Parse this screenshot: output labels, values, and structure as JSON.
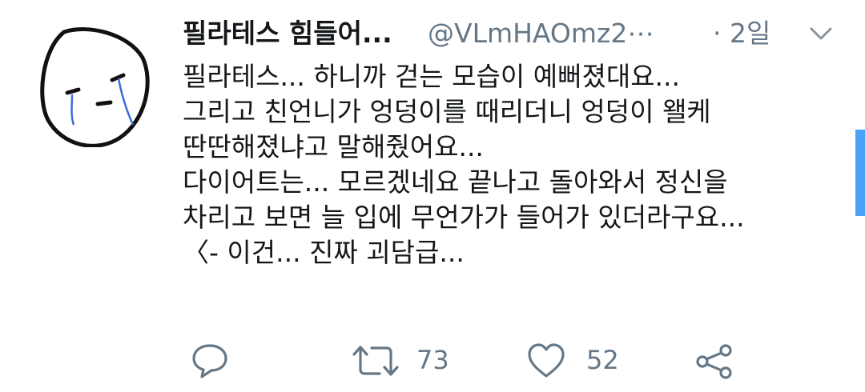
{
  "tweet": {
    "display_name": "필라테스 힘들어...",
    "handle": "@VLmHAOmz2⋯",
    "time": "· 2일",
    "lines": [
      "필라테스... 하니까 걷는 모습이 예뻐졌대요...",
      "그리고 친언니가 엉덩이를 때리더니 엉덩이 왤케",
      "딴딴해졌냐고 말해줬어요...",
      "다이어트는... 모르겠네요 끝나고 돌아와서 정신을",
      "차리고 보면 늘 입에 무언가가 들어가 있더라구요...",
      "〈- 이건... 진짜 괴담급..."
    ]
  },
  "actions": {
    "retweet_count": "73",
    "like_count": "52"
  },
  "icons": {
    "reply": "reply-icon",
    "retweet": "retweet-icon",
    "like": "heart-icon",
    "share": "share-icon",
    "menu": "chevron-down-icon"
  },
  "colors": {
    "text": "#14171a",
    "muted": "#657786",
    "scroll_indicator": "#4aa3f7"
  }
}
